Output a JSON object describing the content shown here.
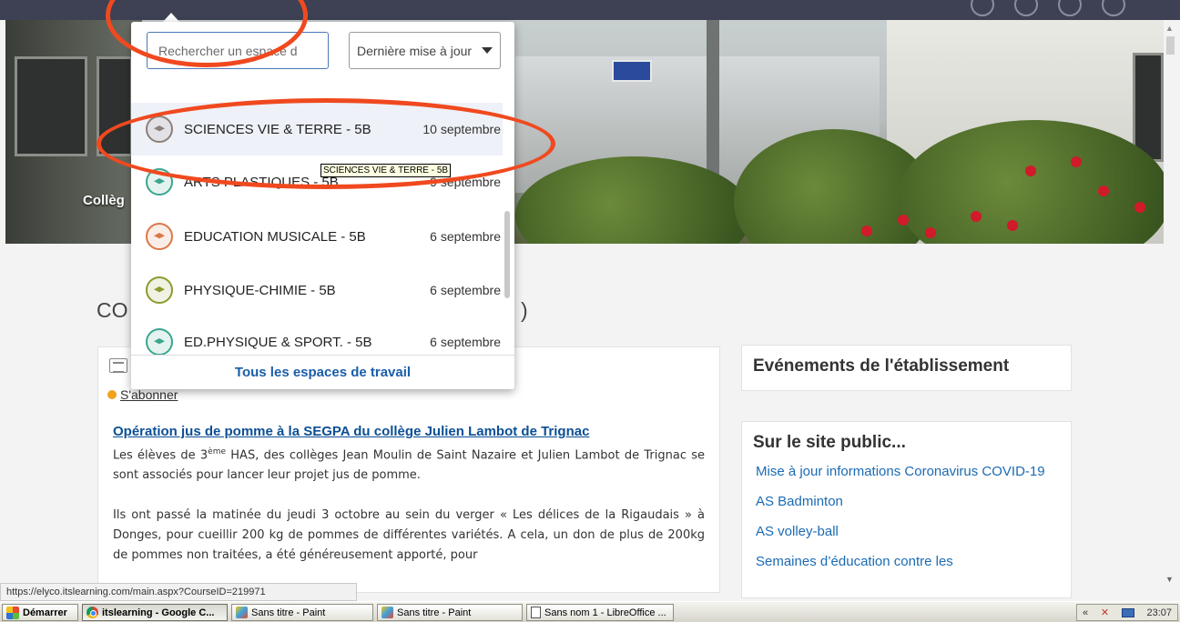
{
  "hero": {
    "title": "Collèg"
  },
  "page_title": {
    "start": "CO",
    "end": ")"
  },
  "dropdown": {
    "search_placeholder": "Rechercher un espace d",
    "sort_selected": "Dernière mise à jour",
    "items": [
      {
        "label": "SCIENCES VIE & TERRE - 5B",
        "date": "10 septembre",
        "color": "#8c8078"
      },
      {
        "label": "ARTS PLASTIQUES - 5B",
        "date": "9 septembre",
        "color": "#3aa68f"
      },
      {
        "label": "EDUCATION MUSICALE - 5B",
        "date": "6 septembre",
        "color": "#d9784a"
      },
      {
        "label": "PHYSIQUE-CHIMIE - 5B",
        "date": "6 septembre",
        "color": "#8e9a2e"
      },
      {
        "label": "ED.PHYSIQUE & SPORT. - 5B",
        "date": "6 septembre",
        "color": "#3aa68f"
      }
    ],
    "footer": "Tous les espaces de travail",
    "tooltip": "SCIENCES VIE & TERRE - 5B"
  },
  "news": {
    "subscribe": "S'abonner",
    "article_title": "Opération jus de pomme à la SEGPA du collège Julien Lambot de Trignac",
    "p1_before": "Les élèves de 3",
    "p1_sup": "ème",
    "p1_after": " HAS, des collèges Jean Moulin de Saint Nazaire et Julien Lambot de Trignac se sont associés pour lancer leur projet jus de pomme.",
    "p2": "Ils ont passé la matinée du jeudi 3 octobre au sein du verger « Les délices de la Rigaudais » à Donges, pour cueillir 200 kg de pommes de différentes variétés. A cela, un don de plus de 200kg de pommes non traitées, a été généreusement apporté, pour"
  },
  "events": {
    "title": "Evénements de l'établissement"
  },
  "public_site": {
    "title": "Sur le site public...",
    "links": [
      "Mise à jour informations Coronavirus COVID-19",
      "AS Badminton",
      "AS volley-ball",
      "Semaines d’éducation contre les"
    ]
  },
  "status_url": "https://elyco.itslearning.com/main.aspx?CourseID=219971",
  "taskbar": {
    "start": "Démarrer",
    "tasks": [
      {
        "label": "itslearning - Google C...",
        "icon": "chrome-icon"
      },
      {
        "label": "Sans titre - Paint",
        "icon": "paint-icon"
      },
      {
        "label": "Sans titre - Paint",
        "icon": "paint-icon"
      },
      {
        "label": "Sans nom 1 - LibreOffice ...",
        "icon": "libreoffice-icon"
      }
    ],
    "tray_chevron": "«",
    "clock": "23:07"
  },
  "colors": {
    "accent": "#1a5ea8",
    "annotation": "#f0491f",
    "topbar": "#3e4154"
  }
}
